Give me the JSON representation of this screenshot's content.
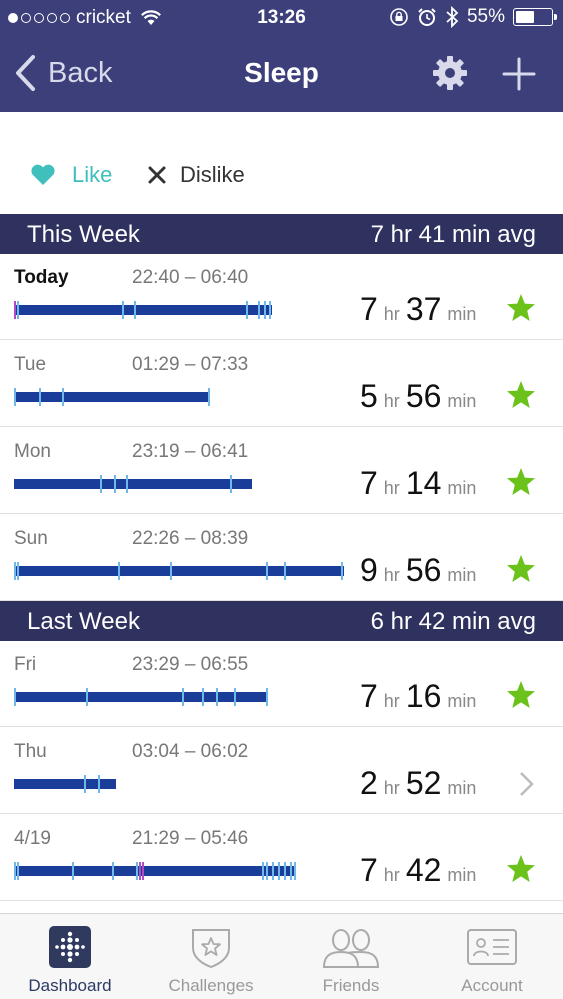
{
  "status_bar": {
    "carrier": "cricket",
    "time": "13:26",
    "battery": "55%",
    "signal_dots_filled": 1,
    "signal_dots_total": 5,
    "battery_level": 0.55
  },
  "nav": {
    "back_label": "Back",
    "title": "Sleep"
  },
  "feedback": {
    "like_label": "Like",
    "dislike_label": "Dislike"
  },
  "this_week": {
    "title": "This Week",
    "avg": "7 hr 41 min avg",
    "rows": [
      {
        "day": "Today",
        "range": "22:40 – 06:40",
        "hours": "7",
        "hr": "hr",
        "minutes": "37",
        "min": "min",
        "status": "star"
      },
      {
        "day": "Tue",
        "range": "01:29 – 07:33",
        "hours": "5",
        "hr": "hr",
        "minutes": "56",
        "min": "min",
        "status": "star"
      },
      {
        "day": "Mon",
        "range": "23:19 – 06:41",
        "hours": "7",
        "hr": "hr",
        "minutes": "14",
        "min": "min",
        "status": "star"
      },
      {
        "day": "Sun",
        "range": "22:26 – 08:39",
        "hours": "9",
        "hr": "hr",
        "minutes": "56",
        "min": "min",
        "status": "star"
      }
    ]
  },
  "last_week": {
    "title": "Last Week",
    "avg": "6 hr 42 min avg",
    "rows": [
      {
        "day": "Fri",
        "range": "23:29 – 06:55",
        "hours": "7",
        "hr": "hr",
        "minutes": "16",
        "min": "min",
        "status": "star"
      },
      {
        "day": "Thu",
        "range": "03:04 – 06:02",
        "hours": "2",
        "hr": "hr",
        "minutes": "52",
        "min": "min",
        "status": "chevron"
      },
      {
        "day": "4/19",
        "range": "21:29 – 05:46",
        "hours": "7",
        "hr": "hr",
        "minutes": "42",
        "min": "min",
        "status": "star"
      }
    ]
  },
  "tabs": [
    {
      "label": "Dashboard",
      "icon": "dashboard-icon",
      "active": true
    },
    {
      "label": "Challenges",
      "icon": "challenges-icon",
      "active": false
    },
    {
      "label": "Friends",
      "icon": "friends-icon",
      "active": false
    },
    {
      "label": "Account",
      "icon": "account-icon",
      "active": false
    }
  ],
  "colors": {
    "header": "#3c3f79",
    "section": "#2f315f",
    "sleep_bar": "#1a3d9a",
    "awake_mark": "#6fb8ea",
    "restless_mark": "#b04cc4",
    "star": "#6bc21a",
    "like": "#3fbfbd"
  }
}
